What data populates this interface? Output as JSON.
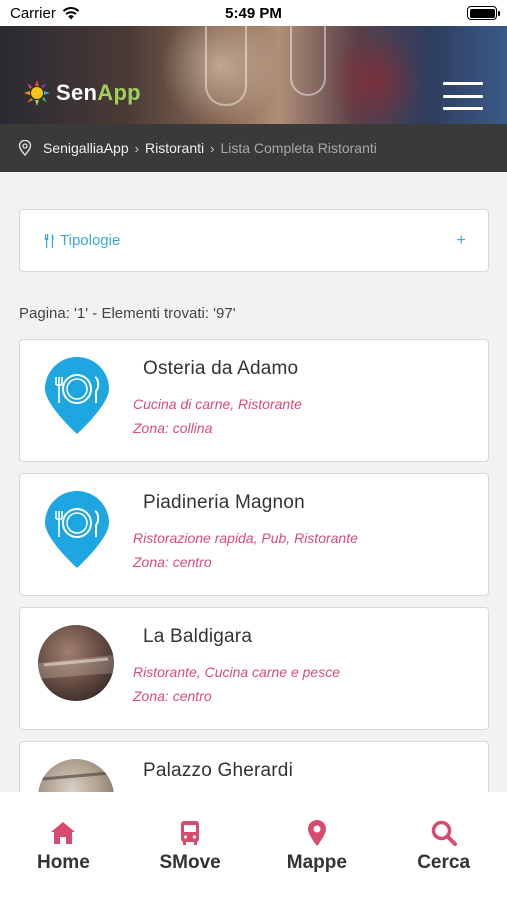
{
  "status_bar": {
    "carrier": "Carrier",
    "time": "5:49 PM",
    "wifi_icon": "wifi-icon",
    "battery_icon": "battery-icon",
    "battery_level": 1.0
  },
  "header": {
    "logo_text_sen": "Sen",
    "logo_text_app": "App",
    "menu_icon": "hamburger-menu-icon"
  },
  "breadcrumb": {
    "icon": "location-pin-icon",
    "items": [
      "SenigalliaApp",
      "Ristoranti",
      "Lista Completa Ristoranti"
    ],
    "separator": "›"
  },
  "filter": {
    "icon": "utensils-icon",
    "label": "Tipologie",
    "expand_symbol": "+"
  },
  "pagination": {
    "text": "Pagina: '1' - Elementi trovati: '97'"
  },
  "restaurants": [
    {
      "name": "Osteria da Adamo",
      "categories": "Cucina di carne, Ristorante",
      "zone": "Zona: collina",
      "image": "restaurant-pin-icon"
    },
    {
      "name": "Piadineria Magnon",
      "categories": "Ristorazione rapida, Pub, Ristorante",
      "zone": "Zona: centro",
      "image": "restaurant-pin-icon"
    },
    {
      "name": "La Baldigara",
      "categories": "Ristorante, Cucina carne e pesce",
      "zone": "Zona: centro",
      "image": "restaurant-photo"
    },
    {
      "name": "Palazzo Gherardi",
      "categories": "",
      "zone": "",
      "image": "restaurant-photo"
    }
  ],
  "tabbar": {
    "accent_color": "#d94b6e",
    "tabs": [
      {
        "label": "Home",
        "icon": "home-icon"
      },
      {
        "label": "SMove",
        "icon": "bus-icon"
      },
      {
        "label": "Mappe",
        "icon": "map-pin-icon"
      },
      {
        "label": "Cerca",
        "icon": "search-icon"
      }
    ]
  },
  "colors": {
    "accent_blue": "#3aa7de",
    "accent_pink": "#d94b78",
    "breadcrumb_bg": "#3a3a3a"
  }
}
